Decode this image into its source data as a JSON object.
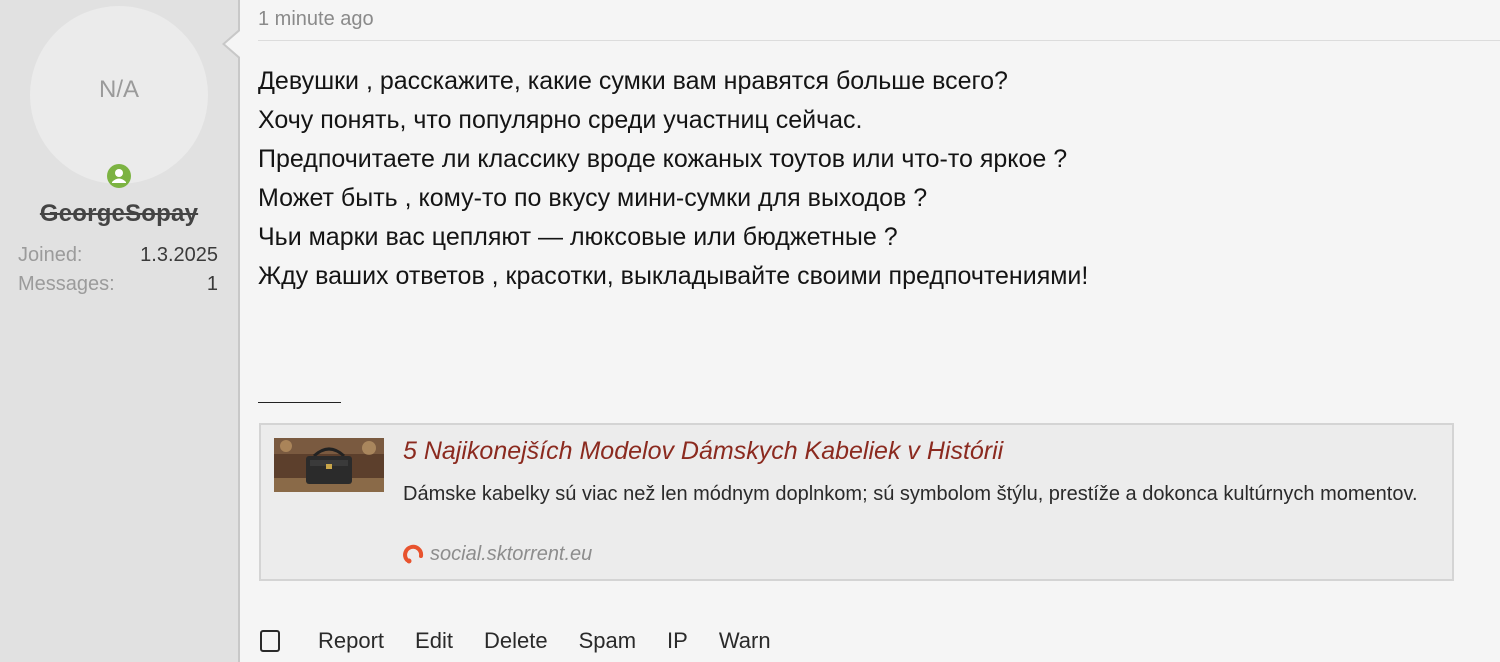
{
  "user": {
    "avatar_text": "N/A",
    "username": "GeorgeSopay",
    "stats": [
      {
        "label": "Joined:",
        "value": "1.3.2025"
      },
      {
        "label": "Messages:",
        "value": "1"
      }
    ],
    "online_icon": "user-online-icon"
  },
  "post": {
    "date": "1 minute ago",
    "lines": [
      "Девушки , расскажите, какие сумки вам нравятся больше всего?",
      "Хочу понять, что популярно среди участниц сейчас.",
      "Предпочитаете ли классику вроде кожаных тоутов или что-то яркое ?",
      "Может быть , кому-то по вкусу мини-сумки для выходов ?",
      "Чьи марки вас цепляют — люксовые или бюджетные ?",
      "Жду ваших ответов , красотки, выкладывайте своими предпочтениями!"
    ]
  },
  "preview": {
    "title": "5 Najikonejších Modelov Dámskych Kabeliek v Histórii",
    "description": "Dámske kabelky sú viac než len módnym doplnkom; sú symbolom štýlu, prestíže a dokonca kultúrnych momentov.",
    "source": "social.sktorrent.eu",
    "source_icon": "site-logo-icon"
  },
  "actions": {
    "report": "Report",
    "edit": "Edit",
    "delete": "Delete",
    "spam": "Spam",
    "ip": "IP",
    "warn": "Warn"
  },
  "colors": {
    "link_title": "#8b2a1f",
    "online_badge": "#7cb342",
    "source_icon": "#e8532e"
  }
}
